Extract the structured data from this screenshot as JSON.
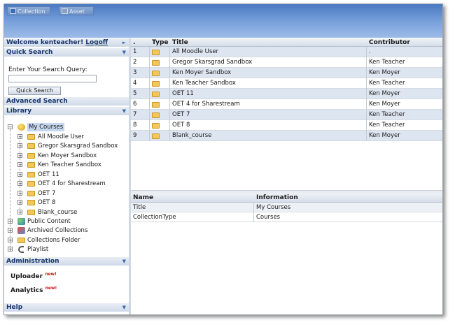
{
  "toolbar": {
    "tabs": [
      {
        "label": "Collection"
      },
      {
        "label": "Asset"
      }
    ]
  },
  "sidebar": {
    "welcome_text": "Welcome kenteacher!",
    "logoff_label": "Logoff",
    "quick_search": {
      "title": "Quick Search",
      "prompt": "Enter Your Search Query:",
      "input_value": "",
      "button_label": "Quick Search"
    },
    "advanced_search_label": "Advanced Search",
    "library": {
      "title": "Library",
      "my_courses": "My Courses",
      "courses": [
        "All Moodle User",
        "Gregor Skarsgrad Sandbox",
        "Ken Moyer Sandbox",
        "Ken Teacher Sandbox",
        "OET 11",
        "OET 4 for Sharestream",
        "OET 7",
        "OET 8",
        "Blank_course"
      ],
      "other_nodes": [
        "Public Content",
        "Archived Collections",
        "Collections Folder",
        "Playlist"
      ]
    },
    "administration": {
      "title": "Administration",
      "items": [
        {
          "label": "Uploader",
          "badge": "new!"
        },
        {
          "label": "Analytics",
          "badge": "new!"
        }
      ]
    },
    "help_title": "Help"
  },
  "grid": {
    "columns": [
      ".",
      "Type",
      "Title",
      "Contributor"
    ],
    "rows": [
      {
        "num": "1",
        "title": "All Moodle User",
        "contributor": "."
      },
      {
        "num": "2",
        "title": "Gregor Skarsgrad Sandbox",
        "contributor": "Ken Teacher"
      },
      {
        "num": "3",
        "title": "Ken Moyer Sandbox",
        "contributor": "Ken Moyer"
      },
      {
        "num": "4",
        "title": "Ken Teacher Sandbox",
        "contributor": "Ken Teacher"
      },
      {
        "num": "5",
        "title": "OET 11",
        "contributor": "Ken Moyer"
      },
      {
        "num": "6",
        "title": "OET 4 for Sharestream",
        "contributor": "Ken Moyer"
      },
      {
        "num": "7",
        "title": "OET 7",
        "contributor": "Ken Teacher"
      },
      {
        "num": "8",
        "title": "OET 8",
        "contributor": "Ken Teacher"
      },
      {
        "num": "9",
        "title": "Blank_course",
        "contributor": "Ken Moyer"
      }
    ]
  },
  "info": {
    "columns": [
      "Name",
      "Information"
    ],
    "rows": [
      {
        "name": "Title",
        "value": "My Courses"
      },
      {
        "name": "CollectionType",
        "value": "Courses"
      }
    ]
  },
  "colors": {
    "header_blue": "#4a79c2",
    "row_alt": "#dde5f0",
    "badge_red": "#d01010"
  }
}
